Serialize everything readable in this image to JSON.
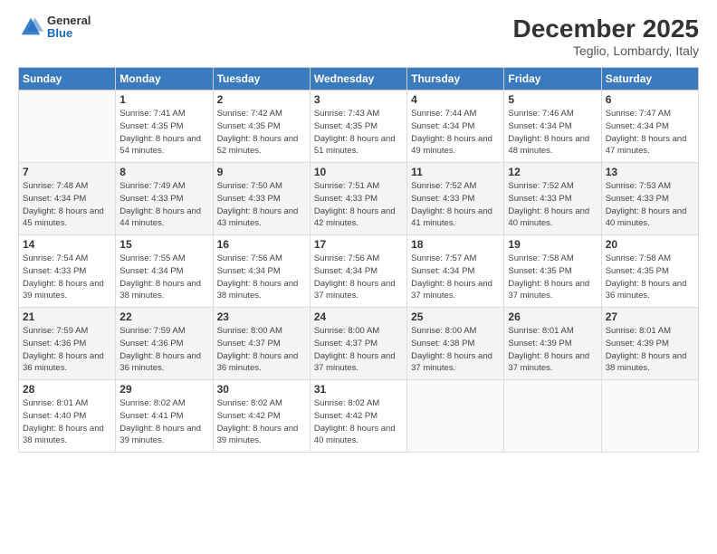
{
  "logo": {
    "general": "General",
    "blue": "Blue"
  },
  "header": {
    "month": "December 2025",
    "location": "Teglio, Lombardy, Italy"
  },
  "weekdays": [
    "Sunday",
    "Monday",
    "Tuesday",
    "Wednesday",
    "Thursday",
    "Friday",
    "Saturday"
  ],
  "weeks": [
    [
      {
        "day": "",
        "sunrise": "",
        "sunset": "",
        "daylight": ""
      },
      {
        "day": "1",
        "sunrise": "Sunrise: 7:41 AM",
        "sunset": "Sunset: 4:35 PM",
        "daylight": "Daylight: 8 hours and 54 minutes."
      },
      {
        "day": "2",
        "sunrise": "Sunrise: 7:42 AM",
        "sunset": "Sunset: 4:35 PM",
        "daylight": "Daylight: 8 hours and 52 minutes."
      },
      {
        "day": "3",
        "sunrise": "Sunrise: 7:43 AM",
        "sunset": "Sunset: 4:35 PM",
        "daylight": "Daylight: 8 hours and 51 minutes."
      },
      {
        "day": "4",
        "sunrise": "Sunrise: 7:44 AM",
        "sunset": "Sunset: 4:34 PM",
        "daylight": "Daylight: 8 hours and 49 minutes."
      },
      {
        "day": "5",
        "sunrise": "Sunrise: 7:46 AM",
        "sunset": "Sunset: 4:34 PM",
        "daylight": "Daylight: 8 hours and 48 minutes."
      },
      {
        "day": "6",
        "sunrise": "Sunrise: 7:47 AM",
        "sunset": "Sunset: 4:34 PM",
        "daylight": "Daylight: 8 hours and 47 minutes."
      }
    ],
    [
      {
        "day": "7",
        "sunrise": "Sunrise: 7:48 AM",
        "sunset": "Sunset: 4:34 PM",
        "daylight": "Daylight: 8 hours and 45 minutes."
      },
      {
        "day": "8",
        "sunrise": "Sunrise: 7:49 AM",
        "sunset": "Sunset: 4:33 PM",
        "daylight": "Daylight: 8 hours and 44 minutes."
      },
      {
        "day": "9",
        "sunrise": "Sunrise: 7:50 AM",
        "sunset": "Sunset: 4:33 PM",
        "daylight": "Daylight: 8 hours and 43 minutes."
      },
      {
        "day": "10",
        "sunrise": "Sunrise: 7:51 AM",
        "sunset": "Sunset: 4:33 PM",
        "daylight": "Daylight: 8 hours and 42 minutes."
      },
      {
        "day": "11",
        "sunrise": "Sunrise: 7:52 AM",
        "sunset": "Sunset: 4:33 PM",
        "daylight": "Daylight: 8 hours and 41 minutes."
      },
      {
        "day": "12",
        "sunrise": "Sunrise: 7:52 AM",
        "sunset": "Sunset: 4:33 PM",
        "daylight": "Daylight: 8 hours and 40 minutes."
      },
      {
        "day": "13",
        "sunrise": "Sunrise: 7:53 AM",
        "sunset": "Sunset: 4:33 PM",
        "daylight": "Daylight: 8 hours and 40 minutes."
      }
    ],
    [
      {
        "day": "14",
        "sunrise": "Sunrise: 7:54 AM",
        "sunset": "Sunset: 4:33 PM",
        "daylight": "Daylight: 8 hours and 39 minutes."
      },
      {
        "day": "15",
        "sunrise": "Sunrise: 7:55 AM",
        "sunset": "Sunset: 4:34 PM",
        "daylight": "Daylight: 8 hours and 38 minutes."
      },
      {
        "day": "16",
        "sunrise": "Sunrise: 7:56 AM",
        "sunset": "Sunset: 4:34 PM",
        "daylight": "Daylight: 8 hours and 38 minutes."
      },
      {
        "day": "17",
        "sunrise": "Sunrise: 7:56 AM",
        "sunset": "Sunset: 4:34 PM",
        "daylight": "Daylight: 8 hours and 37 minutes."
      },
      {
        "day": "18",
        "sunrise": "Sunrise: 7:57 AM",
        "sunset": "Sunset: 4:34 PM",
        "daylight": "Daylight: 8 hours and 37 minutes."
      },
      {
        "day": "19",
        "sunrise": "Sunrise: 7:58 AM",
        "sunset": "Sunset: 4:35 PM",
        "daylight": "Daylight: 8 hours and 37 minutes."
      },
      {
        "day": "20",
        "sunrise": "Sunrise: 7:58 AM",
        "sunset": "Sunset: 4:35 PM",
        "daylight": "Daylight: 8 hours and 36 minutes."
      }
    ],
    [
      {
        "day": "21",
        "sunrise": "Sunrise: 7:59 AM",
        "sunset": "Sunset: 4:36 PM",
        "daylight": "Daylight: 8 hours and 36 minutes."
      },
      {
        "day": "22",
        "sunrise": "Sunrise: 7:59 AM",
        "sunset": "Sunset: 4:36 PM",
        "daylight": "Daylight: 8 hours and 36 minutes."
      },
      {
        "day": "23",
        "sunrise": "Sunrise: 8:00 AM",
        "sunset": "Sunset: 4:37 PM",
        "daylight": "Daylight: 8 hours and 36 minutes."
      },
      {
        "day": "24",
        "sunrise": "Sunrise: 8:00 AM",
        "sunset": "Sunset: 4:37 PM",
        "daylight": "Daylight: 8 hours and 37 minutes."
      },
      {
        "day": "25",
        "sunrise": "Sunrise: 8:00 AM",
        "sunset": "Sunset: 4:38 PM",
        "daylight": "Daylight: 8 hours and 37 minutes."
      },
      {
        "day": "26",
        "sunrise": "Sunrise: 8:01 AM",
        "sunset": "Sunset: 4:39 PM",
        "daylight": "Daylight: 8 hours and 37 minutes."
      },
      {
        "day": "27",
        "sunrise": "Sunrise: 8:01 AM",
        "sunset": "Sunset: 4:39 PM",
        "daylight": "Daylight: 8 hours and 38 minutes."
      }
    ],
    [
      {
        "day": "28",
        "sunrise": "Sunrise: 8:01 AM",
        "sunset": "Sunset: 4:40 PM",
        "daylight": "Daylight: 8 hours and 38 minutes."
      },
      {
        "day": "29",
        "sunrise": "Sunrise: 8:02 AM",
        "sunset": "Sunset: 4:41 PM",
        "daylight": "Daylight: 8 hours and 39 minutes."
      },
      {
        "day": "30",
        "sunrise": "Sunrise: 8:02 AM",
        "sunset": "Sunset: 4:42 PM",
        "daylight": "Daylight: 8 hours and 39 minutes."
      },
      {
        "day": "31",
        "sunrise": "Sunrise: 8:02 AM",
        "sunset": "Sunset: 4:42 PM",
        "daylight": "Daylight: 8 hours and 40 minutes."
      },
      {
        "day": "",
        "sunrise": "",
        "sunset": "",
        "daylight": ""
      },
      {
        "day": "",
        "sunrise": "",
        "sunset": "",
        "daylight": ""
      },
      {
        "day": "",
        "sunrise": "",
        "sunset": "",
        "daylight": ""
      }
    ]
  ]
}
